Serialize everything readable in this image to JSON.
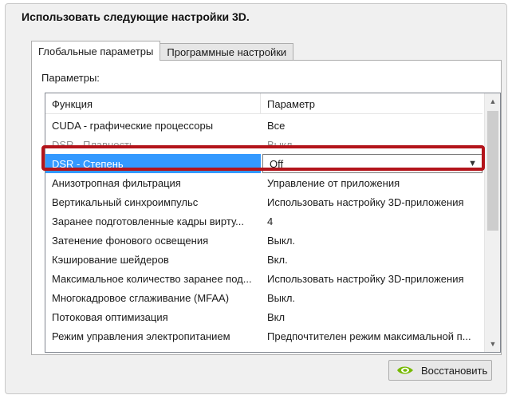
{
  "heading": "Использовать следующие настройки 3D.",
  "tabs": [
    {
      "label": "Глобальные параметры",
      "active": true
    },
    {
      "label": "Программные настройки",
      "active": false
    }
  ],
  "params_label": "Параметры:",
  "columns": {
    "function": "Функция",
    "parameter": "Параметр"
  },
  "rows": [
    {
      "name": "CUDA - графические процессоры",
      "value": "Все"
    },
    {
      "name": "DSR - Плавность",
      "value": "Выкл."
    },
    {
      "name": "DSR - Степень",
      "value": "Off"
    },
    {
      "name": "Анизотропная фильтрация",
      "value": "Управление от приложения"
    },
    {
      "name": "Вертикальный синхроимпульс",
      "value": "Использовать настройку 3D-приложения"
    },
    {
      "name": "Заранее подготовленные кадры вирту...",
      "value": "4"
    },
    {
      "name": "Затенение фонового освещения",
      "value": "Выкл."
    },
    {
      "name": "Кэширование шейдеров",
      "value": "Вкл."
    },
    {
      "name": "Максимальное количество заранее под...",
      "value": "Использовать настройку 3D-приложения"
    },
    {
      "name": "Многокадровое сглаживание (MFAA)",
      "value": "Выкл."
    },
    {
      "name": "Потоковая оптимизация",
      "value": "Вкл"
    },
    {
      "name": "Режим управления электропитанием",
      "value": "Предпочтителен режим максимальной п..."
    }
  ],
  "restore_button": "Восстановить",
  "colors": {
    "selection": "#3399ff",
    "highlight_frame": "#b3141b",
    "nvidia_green": "#76b900"
  },
  "icons": {
    "scroll_up": "chevron-up-icon",
    "scroll_down": "chevron-down-icon",
    "dropdown": "dropdown-arrow-icon",
    "restore": "nvidia-logo-icon"
  }
}
